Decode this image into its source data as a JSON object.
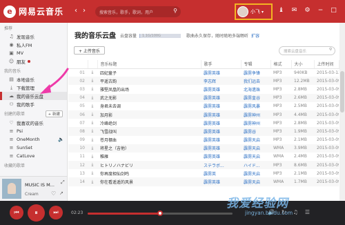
{
  "app": {
    "logo_glyph": "e",
    "name": "网易云音乐"
  },
  "titlebar": {
    "back": "‹",
    "forward": "›",
    "search_placeholder": "搜索音乐，歌手，歌词，用户",
    "user_name": "小飞",
    "icons": [
      "shirt-icon",
      "mail-icon",
      "gear-icon",
      "minimize-icon",
      "restore-icon",
      "close-icon"
    ]
  },
  "sidebar": {
    "recommend_head": "推荐",
    "recommend": [
      {
        "icon": "♫",
        "label": "发现音乐"
      },
      {
        "icon": "◉",
        "label": "私人FM"
      },
      {
        "icon": "▣",
        "label": "MV"
      },
      {
        "icon": "☺",
        "label": "朋友"
      }
    ],
    "my_music_head": "我的音乐",
    "my_music": [
      {
        "icon": "▤",
        "label": "本地音乐"
      },
      {
        "icon": "⤓",
        "label": "下载管理"
      },
      {
        "icon": "☁",
        "label": "我的音乐云盘"
      },
      {
        "icon": "⚇",
        "label": "我的歌手"
      }
    ],
    "created_head": "创建的歌单",
    "new_label": "+ 新建",
    "created": [
      {
        "icon": "♡",
        "label": "我喜欢的音乐"
      },
      {
        "icon": "≡",
        "label": "Psi"
      },
      {
        "icon": "≡",
        "label": "OneMonth"
      },
      {
        "icon": "≡",
        "label": "SunSet"
      },
      {
        "icon": "≡",
        "label": "CatLove"
      }
    ],
    "collected_head": "收藏的歌单"
  },
  "mini_player": {
    "title": "MUSIC IS M...",
    "artist": "Cream",
    "heart": "♡",
    "share": "↗",
    "expand": "⤢"
  },
  "main": {
    "title": "我的音乐云盘",
    "capacity_label": "云盘容量",
    "capacity_value": "1.1G/100G",
    "capacity_fraction": 0.011,
    "notice": "歌曲永久保存，随时随地多端畅听",
    "upgrade": "扩容",
    "upload_label": "+ 上传音乐",
    "search_placeholder": "搜索云盘音乐",
    "columns": [
      "",
      "",
      "音乐标题",
      "歌手",
      "专辑",
      "格式",
      "大小",
      "上传时间"
    ],
    "rows": [
      {
        "n": "01",
        "title": "四妃童子",
        "artist": "霹雳英雄",
        "album": "霹雳争锋",
        "fmt": "MP3",
        "size": "940KB",
        "date": "2015-03-13"
      },
      {
        "n": "02",
        "title": "平遥古韵",
        "artist": "李志辉",
        "album": "我们远去",
        "fmt": "MP3",
        "size": "12.2MB",
        "date": "2015-03-09"
      },
      {
        "n": "03",
        "title": "雅堅凤凰的出场",
        "artist": "霹雳英雄",
        "album": "北海遗珠",
        "fmt": "MP3",
        "size": "2.8MB",
        "date": "2015-03-09"
      },
      {
        "n": "04",
        "title": "武之无影",
        "artist": "霹雳英雄",
        "album": "霹雳皇谷",
        "fmt": "MP3",
        "size": "2.6MB",
        "date": "2015-03-09"
      },
      {
        "n": "05",
        "title": "身君未去调",
        "artist": "霹雳英雄",
        "album": "霹雳风暴",
        "fmt": "MP3",
        "size": "2.5MB",
        "date": "2015-03-09"
      },
      {
        "n": "06",
        "title": "加月影",
        "artist": "霹雳英雄",
        "album": "霹雳神州",
        "fmt": "MP3",
        "size": "4.4MB",
        "date": "2015-03-09"
      },
      {
        "n": "07",
        "title": "冷峰绝剑",
        "artist": "霹雳英雄",
        "album": "霹雳神州",
        "fmt": "MP3",
        "size": "2.8MB",
        "date": "2015-03-09"
      },
      {
        "n": "08",
        "title": "飞雪战叫",
        "artist": "霹雳英雄",
        "album": "霹雳谷",
        "fmt": "MP3",
        "size": "1.9MB",
        "date": "2015-03-09"
      },
      {
        "n": "09",
        "title": "苍月棚血",
        "artist": "霹雳英雄",
        "album": "霹雳天启",
        "fmt": "MP3",
        "size": "2.1MB",
        "date": "2015-03-09"
      },
      {
        "n": "10",
        "title": "将星之（吉他）",
        "artist": "霹雳英雄",
        "album": "霹雳天启",
        "fmt": "WMA",
        "size": "3.9MB",
        "date": "2015-03-09"
      },
      {
        "n": "11",
        "title": "稚雁",
        "artist": "霹雳英雄",
        "album": "霹雳天启",
        "fmt": "WMA",
        "size": "2.4MB",
        "date": "2015-03-09"
      },
      {
        "n": "12",
        "title": "ヒトリノハナビリ",
        "artist": "ステラボ...",
        "album": "ハイド...",
        "fmt": "MP3",
        "size": "8.6MB",
        "date": "2015-03-09"
      },
      {
        "n": "13",
        "title": "你再度相仙剑鸣",
        "artist": "霹雳英",
        "album": "霹雳天启",
        "fmt": "MP3",
        "size": "2.1MB",
        "date": "2015-03-09"
      },
      {
        "n": "14",
        "title": "你在看遥遥的风景",
        "artist": "霹雳英雄",
        "album": "霹雳天启",
        "fmt": "WMA",
        "size": "1.7MB",
        "date": "2015-03-09"
      }
    ]
  },
  "player": {
    "prev": "⏮",
    "play": "⏸",
    "next": "⏭",
    "elapsed": "02:23",
    "progress_fraction": 0.5,
    "icons": [
      "volume-icon",
      "loop-icon",
      "lyrics-icon",
      "playlist-icon"
    ]
  },
  "watermark": {
    "text": "我爱经验网",
    "url": "jingyan.baidu.com"
  }
}
